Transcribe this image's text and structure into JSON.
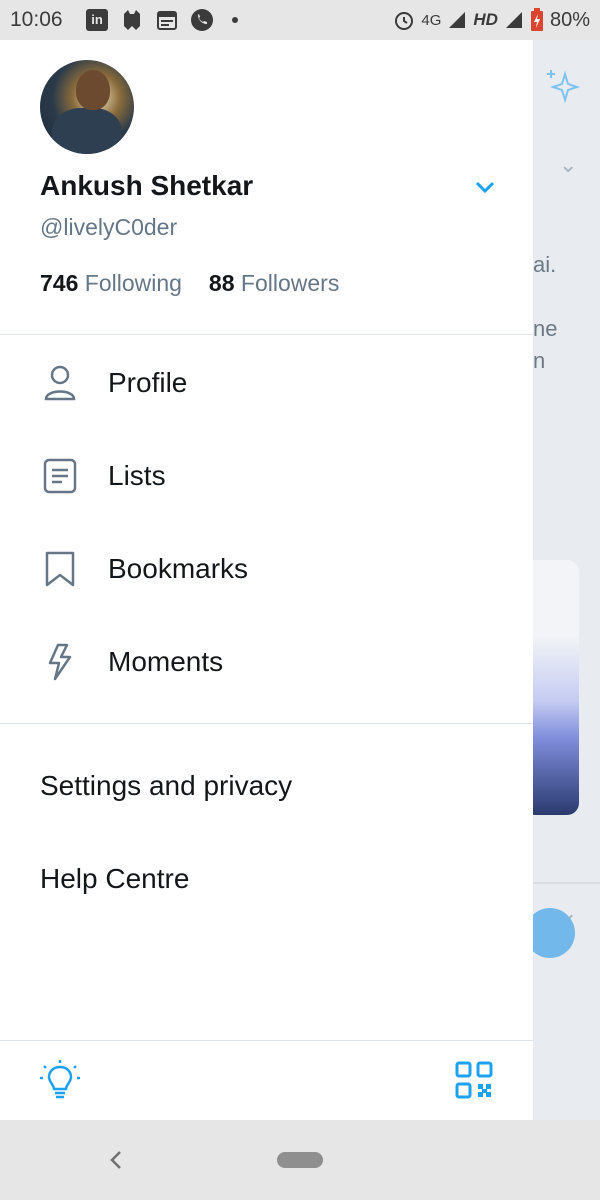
{
  "status_bar": {
    "time": "10:06",
    "network": "4G",
    "hd": "HD",
    "battery": "80%"
  },
  "profile": {
    "name": "Ankush Shetkar",
    "handle": "@livelyC0der",
    "following_count": "746",
    "following_label": "Following",
    "followers_count": "88",
    "followers_label": "Followers"
  },
  "menu": [
    {
      "label": "Profile",
      "icon": "person-icon"
    },
    {
      "label": "Lists",
      "icon": "list-icon"
    },
    {
      "label": "Bookmarks",
      "icon": "bookmark-icon"
    },
    {
      "label": "Moments",
      "icon": "lightning-icon"
    }
  ],
  "secondary_menu": [
    {
      "label": "Settings and privacy"
    },
    {
      "label": "Help Centre"
    }
  ],
  "background_feed": {
    "text_1": "ai.",
    "text_2": "ne",
    "text_3": "n"
  },
  "colors": {
    "accent": "#1da1f2",
    "icon_gray": "#657786",
    "text": "#14171a"
  }
}
